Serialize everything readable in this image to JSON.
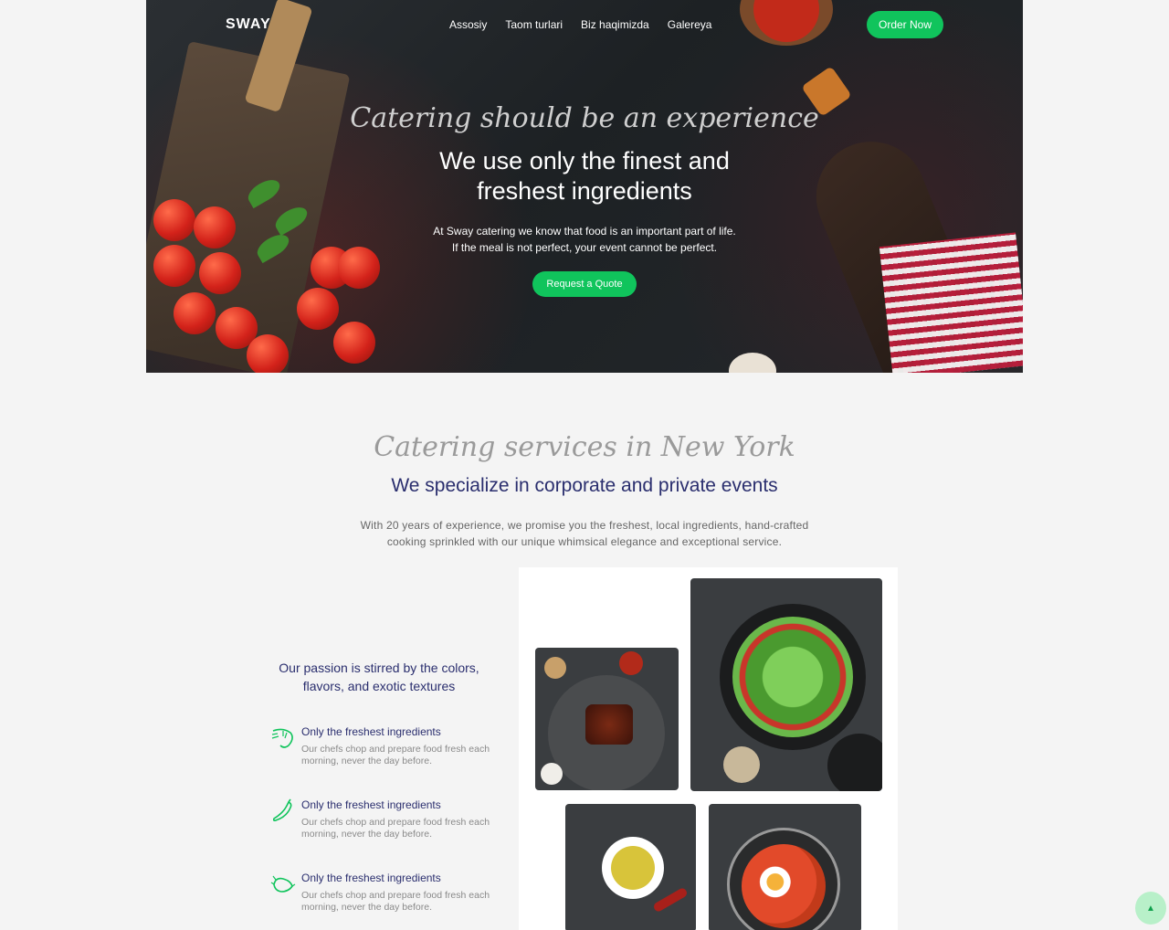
{
  "brand": {
    "name": "SWAY"
  },
  "nav": {
    "items": [
      "Assosiy",
      "Taom turlari",
      "Biz haqimizda",
      "Galereya"
    ]
  },
  "header": {
    "order_label": "Order Now"
  },
  "hero": {
    "script": "Catering should be an experience",
    "title_line1": "We use only the finest and",
    "title_line2": "freshest ingredients",
    "text_line1": "At Sway catering we know that food is an important part of life.",
    "text_line2": "If the meal is not perfect, your event cannot be perfect.",
    "cta_label": "Request a Quote"
  },
  "services": {
    "script": "Catering services in New York",
    "title": "We specialize in corporate and private events",
    "text_line1": "With 20 years of experience, we promise you the freshest, local ingredients, hand-crafted",
    "text_line2": "cooking sprinkled with our unique whimsical elegance and exceptional service."
  },
  "passion": {
    "line1": "Our passion is stirred by the colors,",
    "line2": "flavors, and exotic textures"
  },
  "features": [
    {
      "icon": "shrimp-icon",
      "title": "Only the freshest ingredients",
      "line1": "Our chefs chop and prepare food fresh each",
      "line2": "morning, never the day before."
    },
    {
      "icon": "pepper-icon",
      "title": "Only the freshest ingredients",
      "line1": "Our chefs chop and prepare food fresh each",
      "line2": "morning, never the day before."
    },
    {
      "icon": "chicken-icon",
      "title": "Only the freshest ingredients",
      "line1": "Our chefs chop and prepare food fresh each",
      "line2": "morning, never the day before."
    }
  ],
  "colors": {
    "accent": "#10c45c",
    "heading": "#2a2e6e",
    "background": "#f4f4f4"
  }
}
